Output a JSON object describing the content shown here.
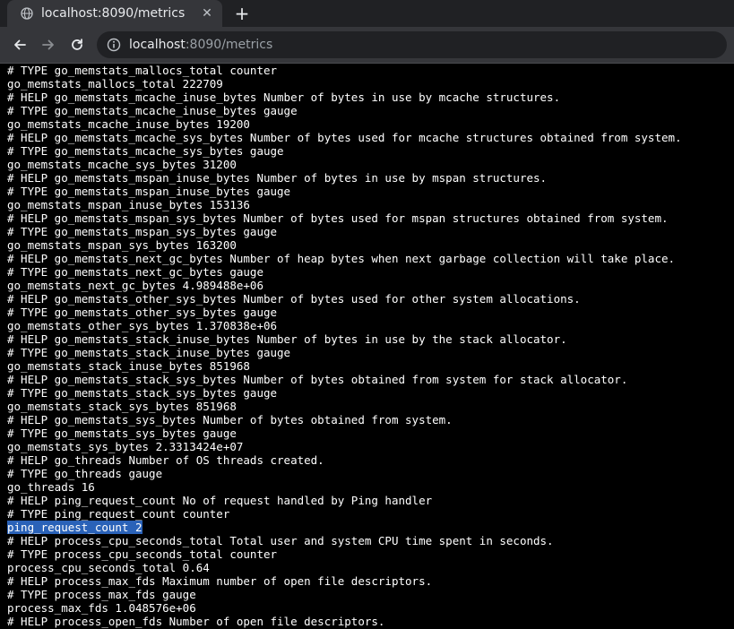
{
  "browser": {
    "tab": {
      "title": "localhost:8090/metrics",
      "favicon": "globe-icon",
      "close_label": "✕"
    },
    "new_tab_label": "+",
    "url": {
      "host": "localhost",
      "rest": ":8090/metrics"
    }
  },
  "page": {
    "selected_line": "ping_request_count 2",
    "lines": [
      "# TYPE go_memstats_mallocs_total counter",
      "go_memstats_mallocs_total 222709",
      "# HELP go_memstats_mcache_inuse_bytes Number of bytes in use by mcache structures.",
      "# TYPE go_memstats_mcache_inuse_bytes gauge",
      "go_memstats_mcache_inuse_bytes 19200",
      "# HELP go_memstats_mcache_sys_bytes Number of bytes used for mcache structures obtained from system.",
      "# TYPE go_memstats_mcache_sys_bytes gauge",
      "go_memstats_mcache_sys_bytes 31200",
      "# HELP go_memstats_mspan_inuse_bytes Number of bytes in use by mspan structures.",
      "# TYPE go_memstats_mspan_inuse_bytes gauge",
      "go_memstats_mspan_inuse_bytes 153136",
      "# HELP go_memstats_mspan_sys_bytes Number of bytes used for mspan structures obtained from system.",
      "# TYPE go_memstats_mspan_sys_bytes gauge",
      "go_memstats_mspan_sys_bytes 163200",
      "# HELP go_memstats_next_gc_bytes Number of heap bytes when next garbage collection will take place.",
      "# TYPE go_memstats_next_gc_bytes gauge",
      "go_memstats_next_gc_bytes 4.989488e+06",
      "# HELP go_memstats_other_sys_bytes Number of bytes used for other system allocations.",
      "# TYPE go_memstats_other_sys_bytes gauge",
      "go_memstats_other_sys_bytes 1.370838e+06",
      "# HELP go_memstats_stack_inuse_bytes Number of bytes in use by the stack allocator.",
      "# TYPE go_memstats_stack_inuse_bytes gauge",
      "go_memstats_stack_inuse_bytes 851968",
      "# HELP go_memstats_stack_sys_bytes Number of bytes obtained from system for stack allocator.",
      "# TYPE go_memstats_stack_sys_bytes gauge",
      "go_memstats_stack_sys_bytes 851968",
      "# HELP go_memstats_sys_bytes Number of bytes obtained from system.",
      "# TYPE go_memstats_sys_bytes gauge",
      "go_memstats_sys_bytes 2.3313424e+07",
      "# HELP go_threads Number of OS threads created.",
      "# TYPE go_threads gauge",
      "go_threads 16",
      "# HELP ping_request_count No of request handled by Ping handler",
      "# TYPE ping_request_count counter",
      "ping_request_count 2",
      "# HELP process_cpu_seconds_total Total user and system CPU time spent in seconds.",
      "# TYPE process_cpu_seconds_total counter",
      "process_cpu_seconds_total 0.64",
      "# HELP process_max_fds Maximum number of open file descriptors.",
      "# TYPE process_max_fds gauge",
      "process_max_fds 1.048576e+06",
      "# HELP process_open_fds Number of open file descriptors."
    ]
  }
}
